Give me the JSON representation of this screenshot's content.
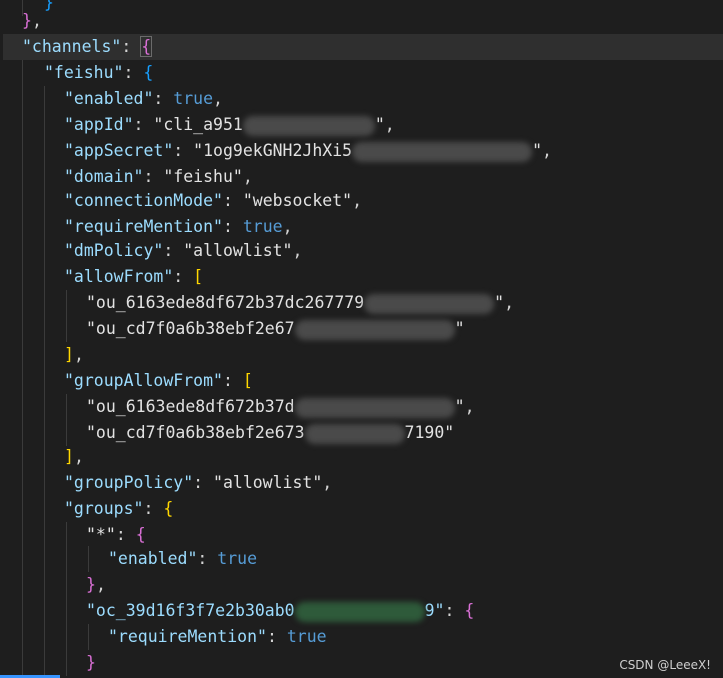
{
  "editor": {
    "lines": [
      {
        "tokens": [
          {
            "t": "}",
            "c": "b3"
          }
        ]
      },
      {
        "tokens": [
          {
            "t": "}",
            "c": "b2"
          },
          {
            "t": ",",
            "c": "punc"
          }
        ]
      },
      {
        "tokens": [
          {
            "t": "\"channels\"",
            "c": "key"
          },
          {
            "t": ": ",
            "c": "punc"
          },
          {
            "t": "{",
            "c": "b2"
          }
        ]
      },
      {
        "tokens": [
          {
            "t": "\"feishu\"",
            "c": "key"
          },
          {
            "t": ": ",
            "c": "punc"
          },
          {
            "t": "{",
            "c": "b3"
          }
        ]
      },
      {
        "tokens": [
          {
            "t": "\"enabled\"",
            "c": "key"
          },
          {
            "t": ": ",
            "c": "punc"
          },
          {
            "t": "true",
            "c": "kw"
          },
          {
            "t": ",",
            "c": "punc"
          }
        ]
      },
      {
        "tokens": [
          {
            "t": "\"appId\"",
            "c": "key"
          },
          {
            "t": ": ",
            "c": "punc"
          },
          {
            "t": "\"cli_a951",
            "c": "str-w"
          },
          {
            "blur": 132
          },
          {
            "t": "\"",
            "c": "str-w"
          },
          {
            "t": ",",
            "c": "punc"
          }
        ]
      },
      {
        "tokens": [
          {
            "t": "\"appSecret\"",
            "c": "key"
          },
          {
            "t": ": ",
            "c": "punc"
          },
          {
            "t": "\"1og9ekGNH2JhXi5",
            "c": "str-w"
          },
          {
            "blur": 180
          },
          {
            "t": "\"",
            "c": "str-w"
          },
          {
            "t": ",",
            "c": "punc"
          }
        ]
      },
      {
        "tokens": [
          {
            "t": "\"domain\"",
            "c": "key"
          },
          {
            "t": ": ",
            "c": "punc"
          },
          {
            "t": "\"feishu\"",
            "c": "str-w"
          },
          {
            "t": ",",
            "c": "punc"
          }
        ]
      },
      {
        "tokens": [
          {
            "t": "\"connectionMode\"",
            "c": "key"
          },
          {
            "t": ": ",
            "c": "punc"
          },
          {
            "t": "\"websocket\"",
            "c": "str-w"
          },
          {
            "t": ",",
            "c": "punc"
          }
        ]
      },
      {
        "tokens": [
          {
            "t": "\"requireMention\"",
            "c": "key"
          },
          {
            "t": ": ",
            "c": "punc"
          },
          {
            "t": "true",
            "c": "kw"
          },
          {
            "t": ",",
            "c": "punc"
          }
        ]
      },
      {
        "tokens": [
          {
            "t": "\"dmPolicy\"",
            "c": "key"
          },
          {
            "t": ": ",
            "c": "punc"
          },
          {
            "t": "\"allowlist\"",
            "c": "str-w"
          },
          {
            "t": ",",
            "c": "punc"
          }
        ]
      },
      {
        "tokens": [
          {
            "t": "\"allowFrom\"",
            "c": "key"
          },
          {
            "t": ": ",
            "c": "punc"
          },
          {
            "t": "[",
            "c": "b1"
          }
        ]
      },
      {
        "tokens": [
          {
            "t": "\"ou_6163ede8df672b37dc267779",
            "c": "str-w"
          },
          {
            "blur": 130
          },
          {
            "t": "\"",
            "c": "str-w"
          },
          {
            "t": ",",
            "c": "punc"
          }
        ]
      },
      {
        "tokens": [
          {
            "t": "\"ou_cd7f0a6b38ebf2e67",
            "c": "str-w"
          },
          {
            "blur": 160
          },
          {
            "t": "\"",
            "c": "str-w"
          }
        ]
      },
      {
        "tokens": [
          {
            "t": "]",
            "c": "b1"
          },
          {
            "t": ",",
            "c": "punc"
          }
        ]
      },
      {
        "tokens": [
          {
            "t": "\"groupAllowFrom\"",
            "c": "key"
          },
          {
            "t": ": ",
            "c": "punc"
          },
          {
            "t": "[",
            "c": "b1"
          }
        ]
      },
      {
        "tokens": [
          {
            "t": "\"ou_6163ede8df672b37d",
            "c": "str-w"
          },
          {
            "blur": 160
          },
          {
            "t": "\"",
            "c": "str-w"
          },
          {
            "t": ",",
            "c": "punc"
          }
        ]
      },
      {
        "tokens": [
          {
            "t": "\"ou_cd7f0a6b38ebf2e673",
            "c": "str-w"
          },
          {
            "blur": 100
          },
          {
            "t": "7190\"",
            "c": "str-w"
          }
        ]
      },
      {
        "tokens": [
          {
            "t": "]",
            "c": "b1"
          },
          {
            "t": ",",
            "c": "punc"
          }
        ]
      },
      {
        "tokens": [
          {
            "t": "\"groupPolicy\"",
            "c": "key"
          },
          {
            "t": ": ",
            "c": "punc"
          },
          {
            "t": "\"allowlist\"",
            "c": "str-w"
          },
          {
            "t": ",",
            "c": "punc"
          }
        ]
      },
      {
        "tokens": [
          {
            "t": "\"groups\"",
            "c": "key"
          },
          {
            "t": ": ",
            "c": "punc"
          },
          {
            "t": "{",
            "c": "b1"
          }
        ]
      },
      {
        "tokens": [
          {
            "t": "\"*\"",
            "c": "str-w"
          },
          {
            "t": ": ",
            "c": "punc"
          },
          {
            "t": "{",
            "c": "b2"
          }
        ]
      },
      {
        "tokens": [
          {
            "t": "\"enabled\"",
            "c": "key"
          },
          {
            "t": ": ",
            "c": "punc"
          },
          {
            "t": "true",
            "c": "kw"
          }
        ]
      },
      {
        "tokens": [
          {
            "t": "}",
            "c": "b2"
          },
          {
            "t": ",",
            "c": "punc"
          }
        ]
      },
      {
        "tokens": [
          {
            "t": "\"oc_39d16f3f7e2b30ab0",
            "c": "key"
          },
          {
            "blur": 130,
            "green": true
          },
          {
            "t": "9\"",
            "c": "key"
          },
          {
            "t": ": ",
            "c": "punc"
          },
          {
            "t": "{",
            "c": "b2"
          }
        ]
      },
      {
        "tokens": [
          {
            "t": "\"requireMention\"",
            "c": "key"
          },
          {
            "t": ": ",
            "c": "punc"
          },
          {
            "t": "true",
            "c": "kw"
          }
        ]
      },
      {
        "tokens": [
          {
            "t": "}",
            "c": "b2"
          }
        ]
      }
    ]
  },
  "watermark": "CSDN @LeeeX!"
}
